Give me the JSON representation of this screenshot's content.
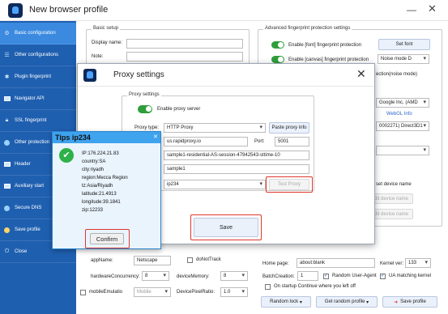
{
  "window": {
    "title": "New browser profile",
    "minimize": "—",
    "close": "✕"
  },
  "sidebar": {
    "items": [
      {
        "label": "Basic configuration"
      },
      {
        "label": "Other configurations"
      },
      {
        "label": "Plugin fingerprint"
      },
      {
        "label": "Navigator API"
      },
      {
        "label": "SSL fingerprint"
      },
      {
        "label": "Other protection"
      },
      {
        "label": "Header"
      },
      {
        "label": "Auxiliary start"
      },
      {
        "label": "Secure DNS"
      },
      {
        "label": "Save profile"
      },
      {
        "label": "Close"
      }
    ]
  },
  "basic_setup": {
    "title": "Basic setup",
    "display_name_label": "Display name:",
    "note_label": "Note:"
  },
  "advanced": {
    "title": "Advanced fingerprint protection settings",
    "enable_font": "Enable [font] fingerprint protection",
    "set_font": "Set font",
    "enable_canvas": "Enable [canvas] fingerprint protection",
    "noise_mode": "Noise mode D",
    "noise_mode_suffix": "ection(noise mode)",
    "webgl_vendor": "Google Inc. (AMD",
    "webgl_info": "WebGL Info",
    "webgl_renderer": "0002271) Direct3D1",
    "set_device_name": "set device name",
    "edit_device_name_1": "Edit device name",
    "edit_device_name_2": "Edit device name"
  },
  "proxy_dialog": {
    "title": "Proxy settings",
    "close": "✕",
    "group_title": "Proxy settings",
    "enable_proxy": "Enable proxy server",
    "proxy_type_label": "Proxy type:",
    "proxy_type_value": "HTTP Proxy",
    "paste_proxy_info": "Paste proxy info",
    "host": "us.rapidproxy.io",
    "port_label": "Port:",
    "port": "5001",
    "username": "sample1-residential-AS-session-47942543-sttime-10",
    "password": "sample1",
    "check_value": "ip234",
    "test_proxy": "Test Proxy",
    "save": "Save"
  },
  "tips": {
    "title": "Tips ip234",
    "close": "✕",
    "lines": [
      "IP:176.224.21.83",
      "country:SA",
      "city:riyadh",
      "region:Mecca Region",
      "tz:Asia/Riyadh",
      "latitude:21.4913",
      "longitude:39.1841",
      "zip:12233"
    ],
    "confirm": "Confirm"
  },
  "bottom": {
    "app_name_label": "appName:",
    "app_name_value": "Netscape",
    "do_not_track": "doNotTrack",
    "hw_concurrency_label": "hardwareConcurrency:",
    "hw_concurrency_value": "8",
    "device_memory_label": "deviceMemory:",
    "device_memory_value": "8",
    "mobile_emulation": "mobileEmulatio",
    "mobile_value": "Mobile",
    "device_pixel_ratio_label": "DevicePixelRatio:",
    "device_pixel_ratio_value": "1.0",
    "home_page_label": "Home page:",
    "home_page_value": "about:blank",
    "kernel_ver_label": "Kernel ver:",
    "kernel_ver_value": "133",
    "batch_creation_label": "BatchCreation:",
    "batch_creation_value": "1",
    "random_user_agent": "Random User-Agent",
    "ua_matching_kernel": "UA matching kernel",
    "startup_continue": "On startup Continue where you left off",
    "random_lock": "Random lock",
    "get_random_profile": "Get random profile",
    "save_profile": "Save profile"
  }
}
